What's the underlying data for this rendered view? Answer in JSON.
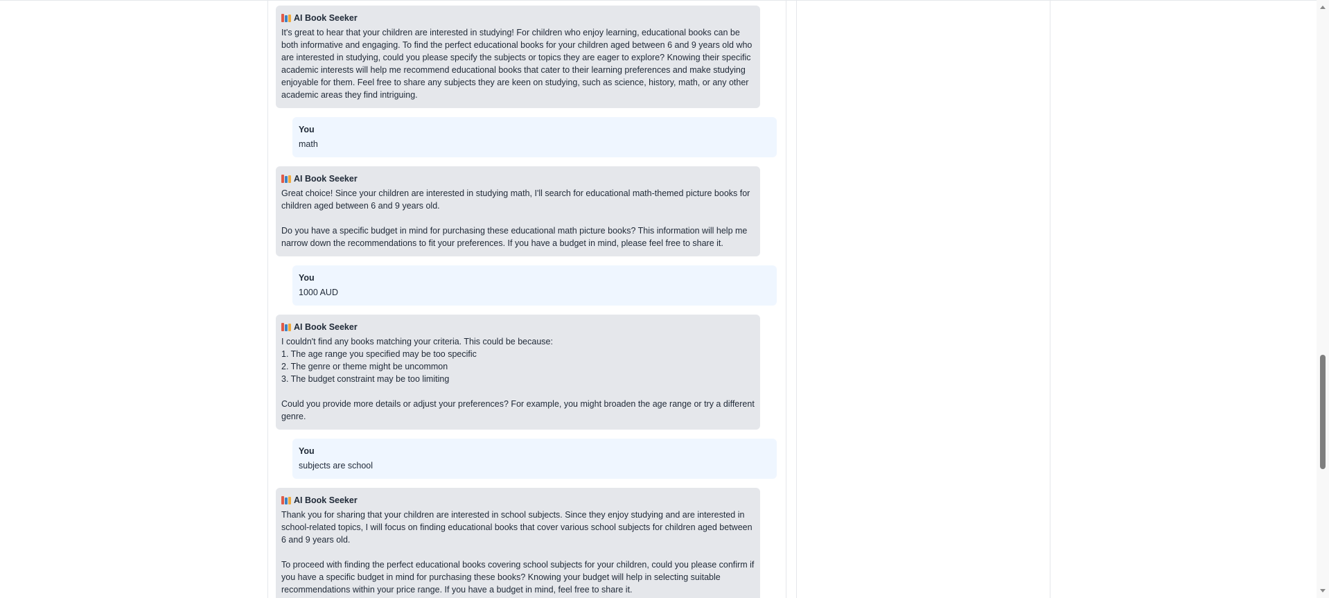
{
  "messages": [
    {
      "role": "assistant",
      "sender": "AI Book Seeker",
      "icon": "books-icon",
      "paragraphs": [
        "It's great to hear that your children are interested in studying! For children who enjoy learning, educational books can be both informative and engaging. To find the perfect educational books for your children aged between 6 and 9 years old who are interested in studying, could you please specify the subjects or topics they are eager to explore? Knowing their specific academic interests will help me recommend educational books that cater to their learning preferences and make studying enjoyable for them. Feel free to share any subjects they are keen on studying, such as science, history, math, or any other academic areas they find intriguing."
      ]
    },
    {
      "role": "user",
      "sender": "You",
      "text": "math"
    },
    {
      "role": "assistant",
      "sender": "AI Book Seeker",
      "icon": "books-icon",
      "paragraphs": [
        "Great choice! Since your children are interested in studying math, I'll search for educational math-themed picture books for children aged between 6 and 9 years old.",
        "Do you have a specific budget in mind for purchasing these educational math picture books? This information will help me narrow down the recommendations to fit your preferences. If you have a budget in mind, please feel free to share it."
      ]
    },
    {
      "role": "user",
      "sender": "You",
      "text": "1000 AUD"
    },
    {
      "role": "assistant",
      "sender": "AI Book Seeker",
      "icon": "books-icon",
      "intro": "I couldn't find any books matching your criteria. This could be because:",
      "list": [
        "1. The age range you specified may be too specific",
        "2. The genre or theme might be uncommon",
        "3. The budget constraint may be too limiting"
      ],
      "outro": "Could you provide more details or adjust your preferences? For example, you might broaden the age range or try a different genre."
    },
    {
      "role": "user",
      "sender": "You",
      "text": "subjects are school"
    },
    {
      "role": "assistant",
      "sender": "AI Book Seeker",
      "icon": "books-icon",
      "paragraphs": [
        "Thank you for sharing that your children are interested in school subjects. Since they enjoy studying and are interested in school-related topics, I will focus on finding educational books that cover various school subjects for children aged between 6 and 9 years old.",
        "To proceed with finding the perfect educational books covering school subjects for your children, could you please confirm if you have a specific budget in mind for purchasing these books? Knowing your budget will help in selecting suitable recommendations within your price range. If you have a budget in mind, feel free to share it."
      ]
    }
  ],
  "colors": {
    "assistant_bubble": "#e5e7eb",
    "user_bubble": "#eff6ff",
    "divider": "#e5e7eb"
  }
}
